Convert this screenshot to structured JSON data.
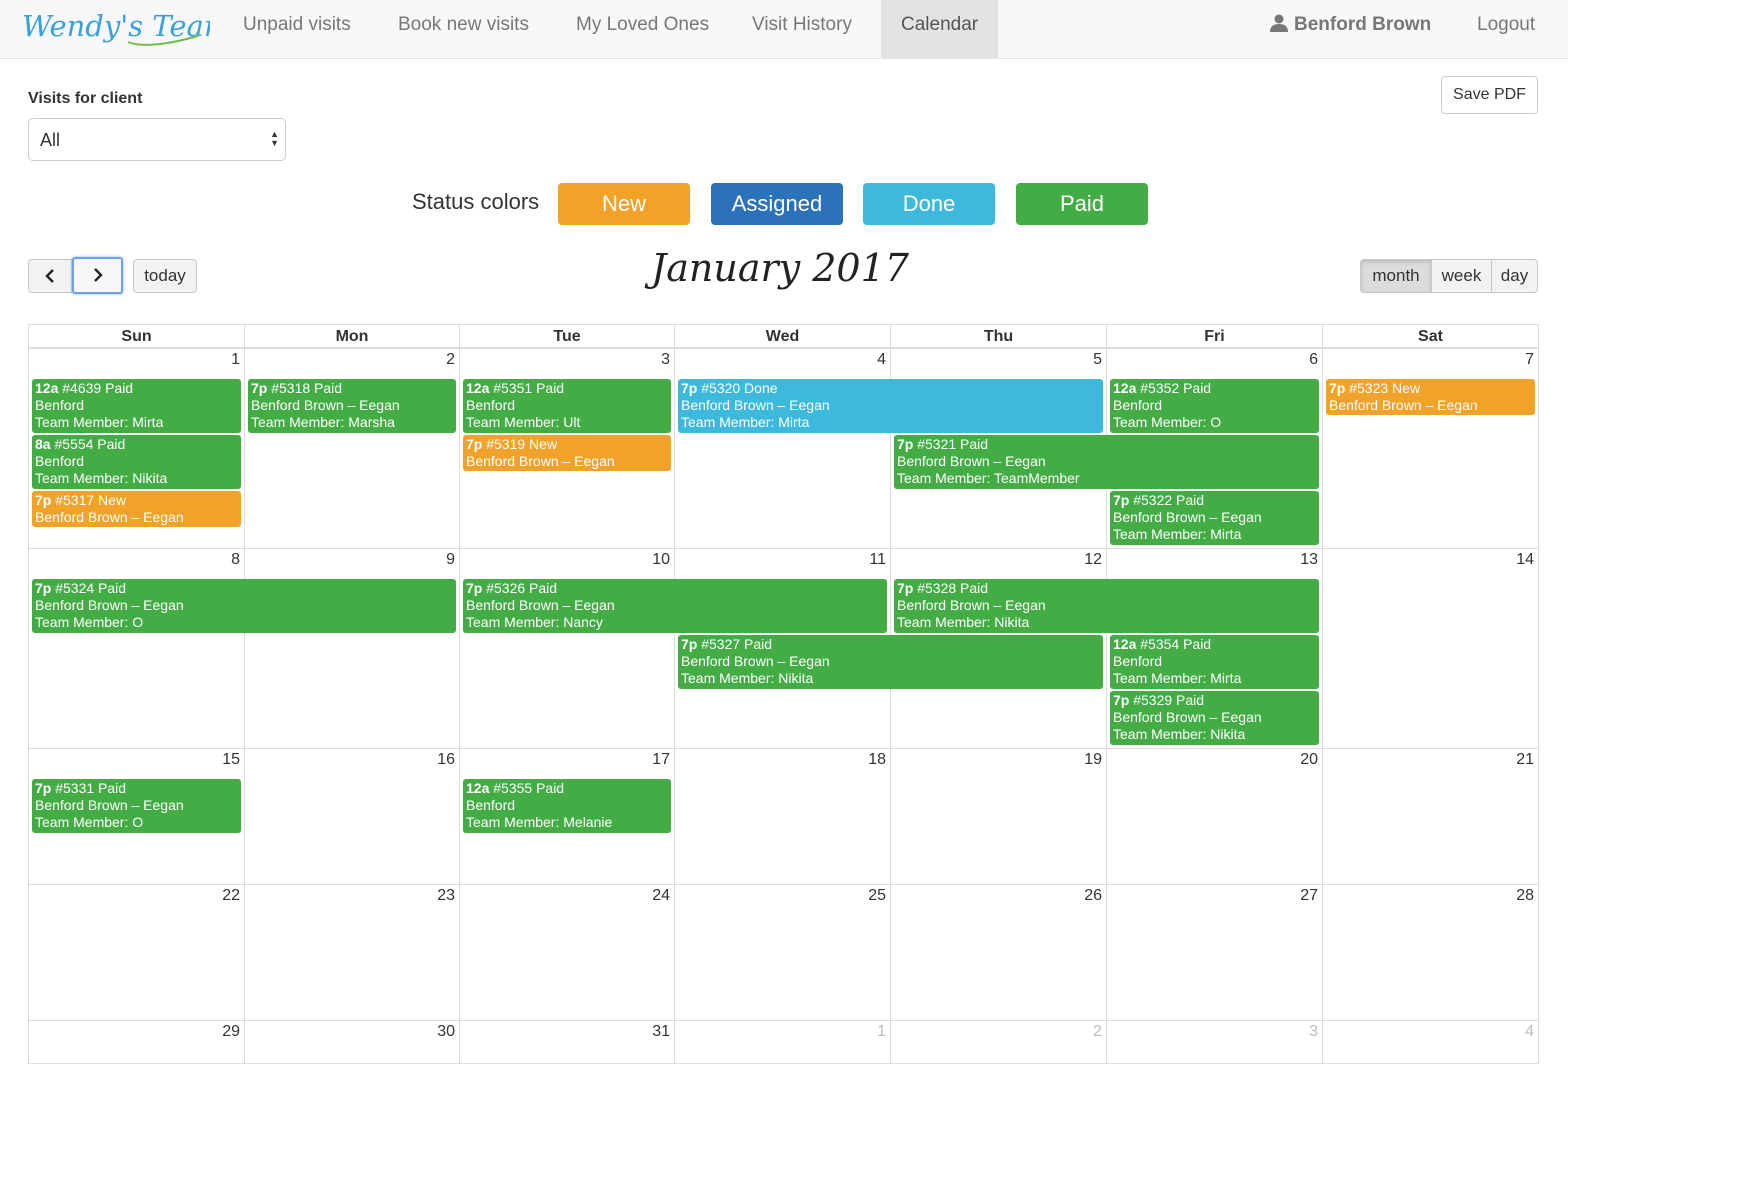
{
  "nav": {
    "logo_text": "Wendy's Team",
    "links": [
      "Unpaid visits",
      "Book new visits",
      "My Loved Ones",
      "Visit History",
      "Calendar"
    ],
    "active": "Calendar",
    "user": "Benford Brown",
    "logout": "Logout"
  },
  "filter": {
    "label": "Visits for client",
    "selected": "All",
    "save_pdf": "Save PDF"
  },
  "status_legend": {
    "label": "Status colors",
    "items": [
      {
        "label": "New",
        "color": "#f0a22a"
      },
      {
        "label": "Assigned",
        "color": "#2c72b8"
      },
      {
        "label": "Done",
        "color": "#3db9dc"
      },
      {
        "label": "Paid",
        "color": "#44ac45"
      }
    ]
  },
  "toolbar": {
    "today": "today",
    "title": "January 2017",
    "views": [
      "month",
      "week",
      "day"
    ],
    "active_view": "month"
  },
  "calendar": {
    "weekdays": [
      "Sun",
      "Mon",
      "Tue",
      "Wed",
      "Thu",
      "Fri",
      "Sat"
    ],
    "weeks": [
      [
        1,
        2,
        3,
        4,
        5,
        6,
        7
      ],
      [
        8,
        9,
        10,
        11,
        12,
        13,
        14
      ],
      [
        15,
        16,
        17,
        18,
        19,
        20,
        21
      ],
      [
        22,
        23,
        24,
        25,
        26,
        27,
        28
      ],
      [
        29,
        30,
        31,
        1,
        2,
        3,
        4
      ]
    ],
    "other_month_days": [
      [
        4,
        3
      ],
      [
        4,
        4
      ],
      [
        4,
        5
      ],
      [
        4,
        6
      ]
    ],
    "events": [
      {
        "week": 0,
        "start": 0,
        "span": 1,
        "slot": 0,
        "status": "Paid",
        "time": "12a",
        "title": "#4639 Paid",
        "client": "Benford",
        "member": "Team Member: Mirta"
      },
      {
        "week": 0,
        "start": 0,
        "span": 1,
        "slot": 1,
        "status": "Paid",
        "time": "8a",
        "title": "#5554 Paid",
        "client": "Benford",
        "member": "Team Member: Nikita"
      },
      {
        "week": 0,
        "start": 0,
        "span": 1,
        "slot": 2,
        "status": "New",
        "time": "7p",
        "title": "#5317 New",
        "client": "Benford Brown – Eegan",
        "member": ""
      },
      {
        "week": 0,
        "start": 1,
        "span": 1,
        "slot": 0,
        "status": "Paid",
        "time": "7p",
        "title": "#5318 Paid",
        "client": "Benford Brown – Eegan",
        "member": "Team Member: Marsha"
      },
      {
        "week": 0,
        "start": 2,
        "span": 1,
        "slot": 0,
        "status": "Paid",
        "time": "12a",
        "title": "#5351 Paid",
        "client": "Benford",
        "member": "Team Member: Ult"
      },
      {
        "week": 0,
        "start": 2,
        "span": 1,
        "slot": 1,
        "status": "New",
        "time": "7p",
        "title": "#5319 New",
        "client": "Benford Brown – Eegan",
        "member": ""
      },
      {
        "week": 0,
        "start": 3,
        "span": 2,
        "slot": 0,
        "status": "Done",
        "time": "7p",
        "title": "#5320 Done",
        "client": "Benford Brown – Eegan",
        "member": "Team Member: Mirta"
      },
      {
        "week": 0,
        "start": 4,
        "span": 2,
        "slot": 1,
        "status": "Paid",
        "time": "7p",
        "title": "#5321 Paid",
        "client": "Benford Brown – Eegan",
        "member": "Team Member: TeamMember"
      },
      {
        "week": 0,
        "start": 5,
        "span": 1,
        "slot": 0,
        "status": "Paid",
        "time": "12a",
        "title": "#5352 Paid",
        "client": "Benford",
        "member": "Team Member: O"
      },
      {
        "week": 0,
        "start": 5,
        "span": 1,
        "slot": 2,
        "status": "Paid",
        "time": "7p",
        "title": "#5322 Paid",
        "client": "Benford Brown – Eegan",
        "member": "Team Member: Mirta"
      },
      {
        "week": 0,
        "start": 6,
        "span": 1,
        "slot": 0,
        "status": "New",
        "time": "7p",
        "title": "#5323 New",
        "client": "Benford Brown – Eegan",
        "member": ""
      },
      {
        "week": 1,
        "start": 0,
        "span": 2,
        "slot": 0,
        "status": "Paid",
        "time": "7p",
        "title": "#5324 Paid",
        "client": "Benford Brown – Eegan",
        "member": "Team Member: O"
      },
      {
        "week": 1,
        "start": 2,
        "span": 2,
        "slot": 0,
        "status": "Paid",
        "time": "7p",
        "title": "#5326 Paid",
        "client": "Benford Brown – Eegan",
        "member": "Team Member: Nancy"
      },
      {
        "week": 1,
        "start": 3,
        "span": 2,
        "slot": 1,
        "status": "Paid",
        "time": "7p",
        "title": "#5327 Paid",
        "client": "Benford Brown – Eegan",
        "member": "Team Member: Nikita"
      },
      {
        "week": 1,
        "start": 4,
        "span": 2,
        "slot": 0,
        "status": "Paid",
        "time": "7p",
        "title": "#5328 Paid",
        "client": "Benford Brown – Eegan",
        "member": "Team Member: Nikita"
      },
      {
        "week": 1,
        "start": 5,
        "span": 1,
        "slot": 1,
        "status": "Paid",
        "time": "12a",
        "title": "#5354 Paid",
        "client": "Benford",
        "member": "Team Member: Mirta"
      },
      {
        "week": 1,
        "start": 5,
        "span": 1,
        "slot": 2,
        "status": "Paid",
        "time": "7p",
        "title": "#5329 Paid",
        "client": "Benford Brown – Eegan",
        "member": "Team Member: Nikita"
      },
      {
        "week": 2,
        "start": 0,
        "span": 1,
        "slot": 0,
        "status": "Paid",
        "time": "7p",
        "title": "#5331 Paid",
        "client": "Benford Brown – Eegan",
        "member": "Team Member: O"
      },
      {
        "week": 2,
        "start": 2,
        "span": 1,
        "slot": 0,
        "status": "Paid",
        "time": "12a",
        "title": "#5355 Paid",
        "client": "Benford",
        "member": "Team Member: Melanie"
      }
    ]
  }
}
